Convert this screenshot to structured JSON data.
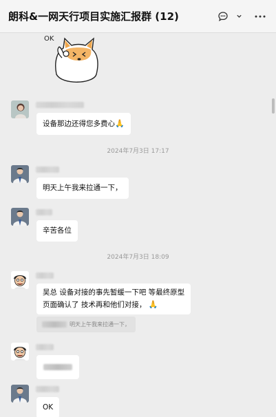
{
  "header": {
    "title": "朗科&一网天行项目实施汇报群 (12)",
    "chat_icon": "chat-bubble-icon",
    "dropdown_icon": "chevron-down-icon",
    "more_icon": "more-icon"
  },
  "sticker": {
    "label": "OK"
  },
  "messages": [
    {
      "text": "设备那边还得您多费心",
      "emoji": "🙏"
    },
    {
      "timestamp": "2024年7月3日 17:17"
    },
    {
      "text": "明天上午我来拉通一下，"
    },
    {
      "text": "辛苦各位"
    },
    {
      "timestamp": "2024年7月3日 18:09"
    },
    {
      "line1": "吴总 设备对接的事先暂缓一下吧 等最终原型",
      "line2": "页面确认了 技术再和他们对接，",
      "emoji": "🙏",
      "quote": "明天上午我来拉通一下，"
    },
    {
      "text": ""
    },
    {
      "text": "OK"
    }
  ],
  "colors": {
    "background": "#ededed",
    "bubble": "#ffffff",
    "accent": "#e6a428"
  }
}
